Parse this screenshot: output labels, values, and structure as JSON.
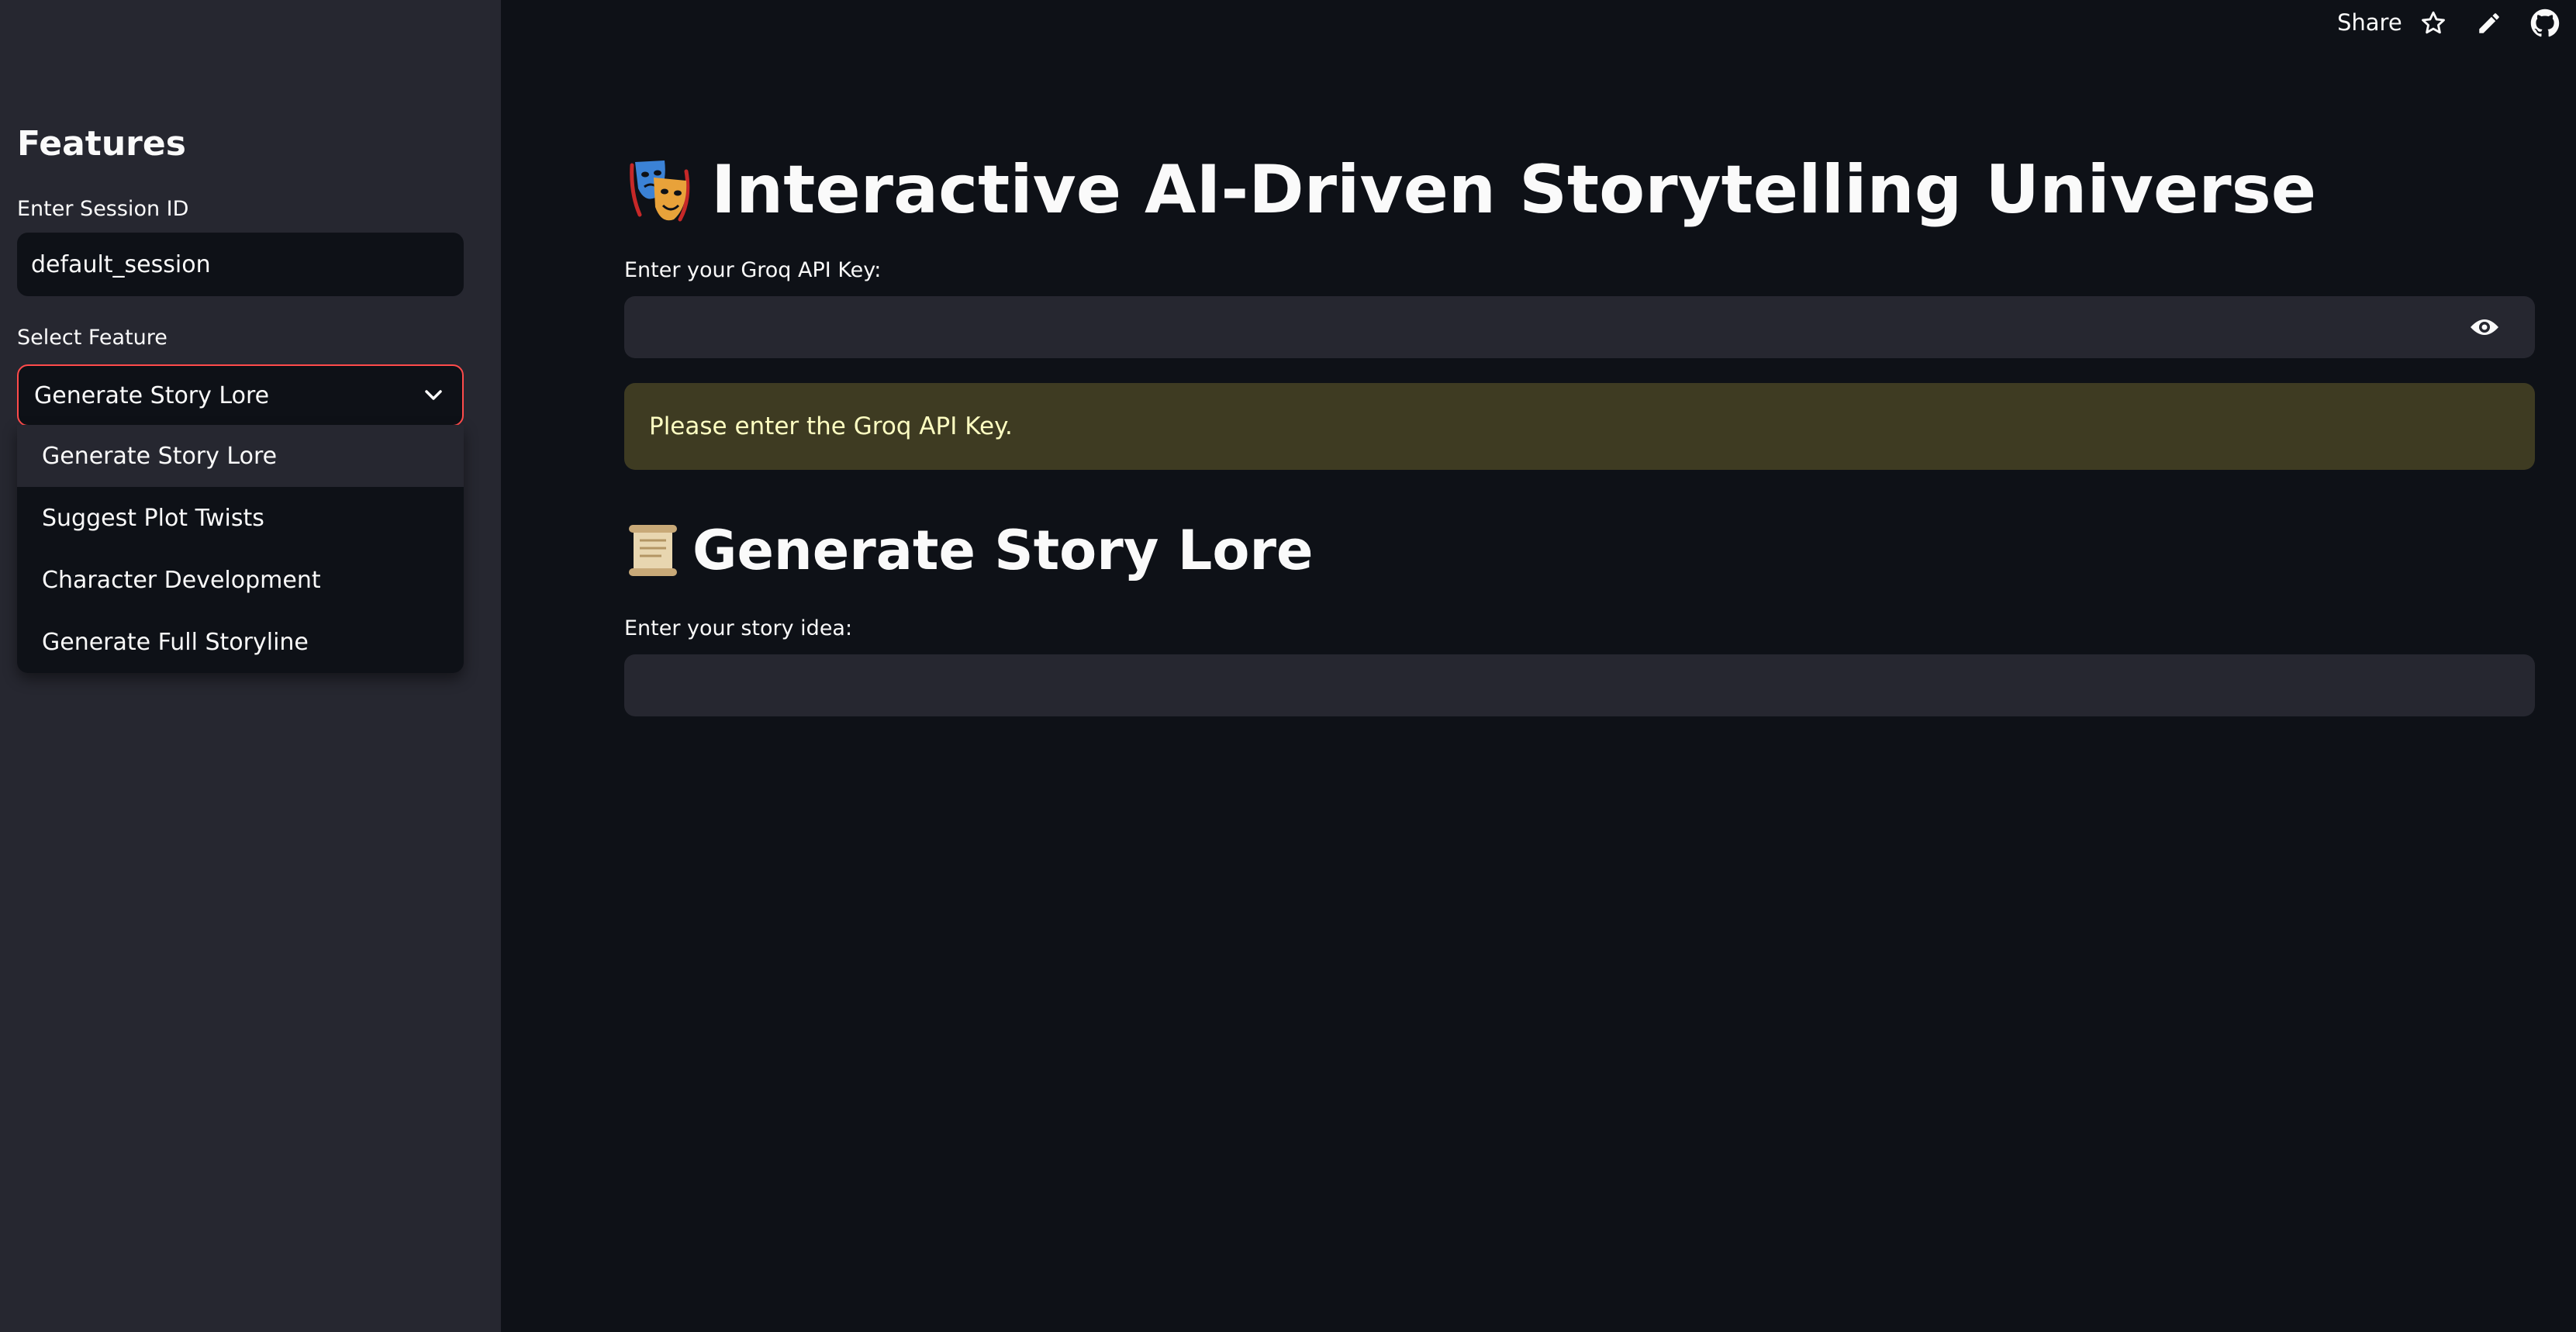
{
  "sidebar": {
    "title": "Features",
    "session_label": "Enter Session ID",
    "session_value": "default_session",
    "select_label": "Select Feature",
    "selected_feature": "Generate Story Lore",
    "options": [
      "Generate Story Lore",
      "Suggest Plot Twists",
      "Character Development",
      "Generate Full Storyline"
    ]
  },
  "toolbar": {
    "share_label": "Share",
    "icons": [
      "star-icon",
      "edit-pencil-icon",
      "github-icon"
    ]
  },
  "main": {
    "title": "Interactive AI-Driven Storytelling Universe",
    "title_icon": "performing-arts-masks-icon",
    "api_key_label": "Enter your Groq API Key:",
    "api_key_value": "",
    "warning_text": "Please enter the Groq API Key.",
    "section_title": "Generate Story Lore",
    "section_icon": "scroll-icon",
    "story_label": "Enter your story idea:",
    "story_value": ""
  },
  "colors": {
    "background": "#0e1117",
    "sidebar": "#262730",
    "accent": "#ff4b4b",
    "warning_bg": "#3e3b22",
    "warning_text": "#ffffc2"
  }
}
